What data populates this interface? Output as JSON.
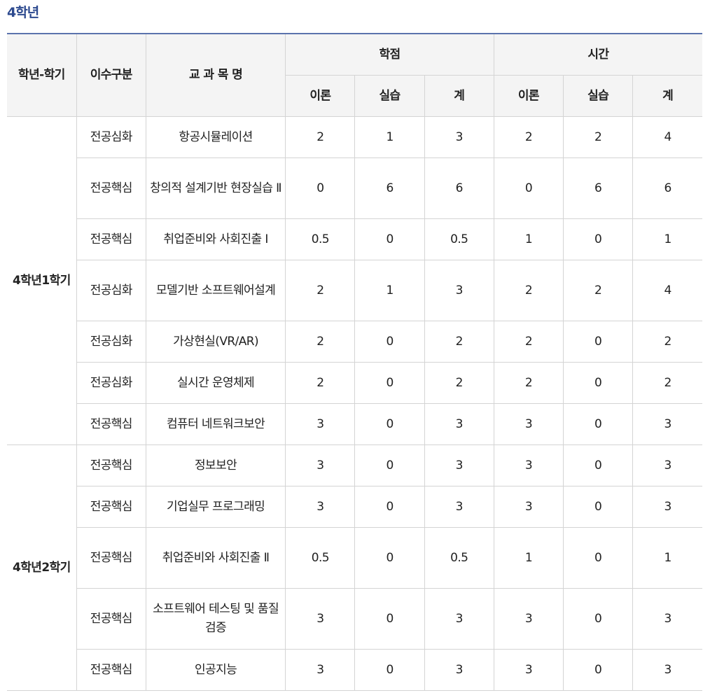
{
  "heading": "4학년",
  "header": {
    "grade_semester": "학년-학기",
    "category": "이수구분",
    "course_name": "교 과 목 명",
    "credits": "학점",
    "hours": "시간",
    "theory": "이론",
    "practice": "실습",
    "total": "계"
  },
  "groups": [
    {
      "semester": "4학년1학기",
      "rows": [
        {
          "category": "전공심화",
          "name": "항공시뮬레이션",
          "c_theory": "2",
          "c_practice": "1",
          "c_total": "3",
          "h_theory": "2",
          "h_practice": "2",
          "h_total": "4"
        },
        {
          "category": "전공핵심",
          "name": "창의적 설계기반 현장실습 Ⅱ",
          "c_theory": "0",
          "c_practice": "6",
          "c_total": "6",
          "h_theory": "0",
          "h_practice": "6",
          "h_total": "6"
        },
        {
          "category": "전공핵심",
          "name": "취업준비와 사회진출 Ⅰ",
          "c_theory": "0.5",
          "c_practice": "0",
          "c_total": "0.5",
          "h_theory": "1",
          "h_practice": "0",
          "h_total": "1"
        },
        {
          "category": "전공심화",
          "name": "모델기반 소프트웨어설계",
          "c_theory": "2",
          "c_practice": "1",
          "c_total": "3",
          "h_theory": "2",
          "h_practice": "2",
          "h_total": "4"
        },
        {
          "category": "전공심화",
          "name": "가상현실(VR/AR)",
          "c_theory": "2",
          "c_practice": "0",
          "c_total": "2",
          "h_theory": "2",
          "h_practice": "0",
          "h_total": "2"
        },
        {
          "category": "전공심화",
          "name": "실시간 운영체제",
          "c_theory": "2",
          "c_practice": "0",
          "c_total": "2",
          "h_theory": "2",
          "h_practice": "0",
          "h_total": "2"
        },
        {
          "category": "전공핵심",
          "name": "컴퓨터 네트워크보안",
          "c_theory": "3",
          "c_practice": "0",
          "c_total": "3",
          "h_theory": "3",
          "h_practice": "0",
          "h_total": "3"
        }
      ]
    },
    {
      "semester": "4학년2학기",
      "rows": [
        {
          "category": "전공핵심",
          "name": "정보보안",
          "c_theory": "3",
          "c_practice": "0",
          "c_total": "3",
          "h_theory": "3",
          "h_practice": "0",
          "h_total": "3"
        },
        {
          "category": "전공핵심",
          "name": "기업실무 프로그래밍",
          "c_theory": "3",
          "c_practice": "0",
          "c_total": "3",
          "h_theory": "3",
          "h_practice": "0",
          "h_total": "3"
        },
        {
          "category": "전공핵심",
          "name": "취업준비와 사회진출 Ⅱ",
          "c_theory": "0.5",
          "c_practice": "0",
          "c_total": "0.5",
          "h_theory": "1",
          "h_practice": "0",
          "h_total": "1"
        },
        {
          "category": "전공핵심",
          "name": "소프트웨어 테스팅 및 품질검증",
          "c_theory": "3",
          "c_practice": "0",
          "c_total": "3",
          "h_theory": "3",
          "h_practice": "0",
          "h_total": "3"
        },
        {
          "category": "전공핵심",
          "name": "인공지능",
          "c_theory": "3",
          "c_practice": "0",
          "c_total": "3",
          "h_theory": "3",
          "h_practice": "0",
          "h_total": "3"
        }
      ]
    }
  ]
}
